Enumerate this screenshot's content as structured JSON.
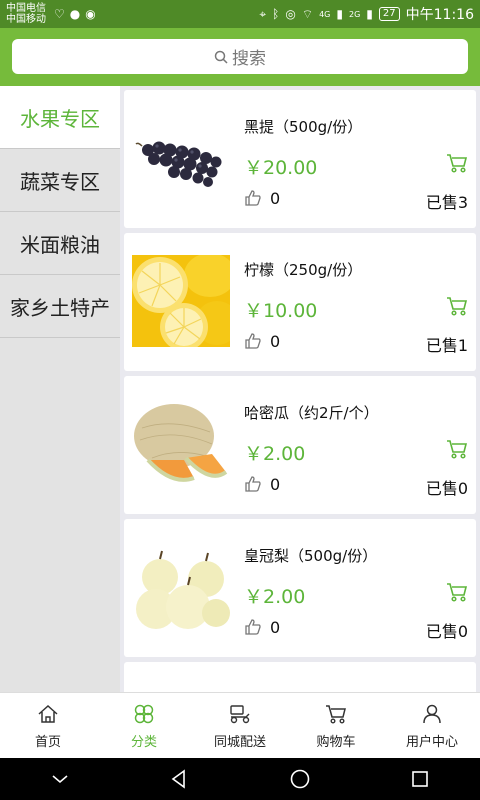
{
  "status_bar": {
    "carrier_1": "中国电信",
    "carrier_2": "中国移动",
    "network_1": "4G",
    "network_2": "2G",
    "battery": "27",
    "time": "中午11:16"
  },
  "search": {
    "placeholder": "搜索"
  },
  "categories": [
    {
      "label": "水果专区",
      "active": true
    },
    {
      "label": "蔬菜专区",
      "active": false
    },
    {
      "label": "米面粮油",
      "active": false
    },
    {
      "label": "家乡土特产",
      "active": false
    }
  ],
  "products": [
    {
      "name": "黑提（500g/份）",
      "price": "￥20.00",
      "likes": "0",
      "sold": "已售3",
      "image": "grapes"
    },
    {
      "name": "柠檬（250g/份）",
      "price": "￥10.00",
      "likes": "0",
      "sold": "已售1",
      "image": "lemons"
    },
    {
      "name": "哈密瓜（约2斤/个）",
      "price": "￥2.00",
      "likes": "0",
      "sold": "已售0",
      "image": "melon"
    },
    {
      "name": "皇冠梨（500g/份）",
      "price": "￥2.00",
      "likes": "0",
      "sold": "已售0",
      "image": "pears"
    }
  ],
  "tabs": [
    {
      "label": "首页",
      "icon": "home-icon",
      "active": false
    },
    {
      "label": "分类",
      "icon": "category-icon",
      "active": true
    },
    {
      "label": "同城配送",
      "icon": "delivery-icon",
      "active": false
    },
    {
      "label": "购物车",
      "icon": "cart-icon",
      "active": false
    },
    {
      "label": "用户中心",
      "icon": "user-icon",
      "active": false
    }
  ],
  "colors": {
    "accent": "#5db53a",
    "header": "#76bb3b",
    "statusbar": "#4f8a27"
  }
}
